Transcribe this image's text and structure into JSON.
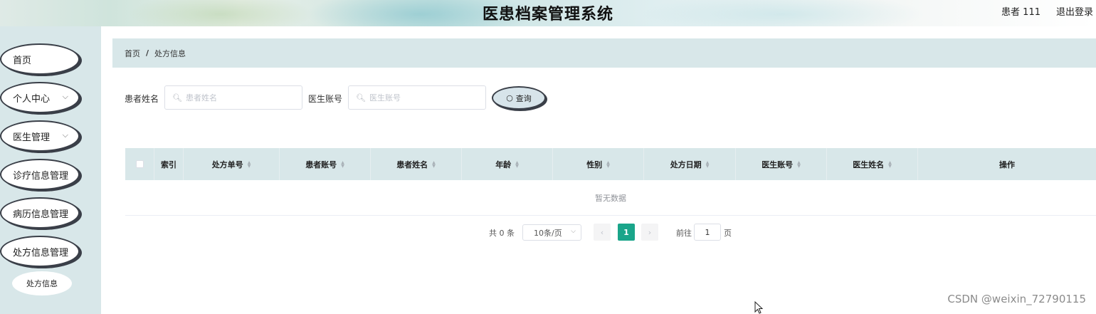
{
  "header": {
    "title": "医患档案管理系统",
    "user": "患者 111",
    "logout": "退出登录"
  },
  "sidebar": {
    "items": [
      {
        "label": "首页",
        "has_children": false
      },
      {
        "label": "个人中心",
        "has_children": true
      },
      {
        "label": "医生管理",
        "has_children": true
      },
      {
        "label": "诊疗信息管理",
        "has_children": false
      },
      {
        "label": "病历信息管理",
        "has_children": false
      },
      {
        "label": "处方信息管理",
        "has_children": false
      }
    ],
    "submenu": {
      "label": "处方信息"
    }
  },
  "breadcrumb": {
    "home": "首页",
    "separator": "/",
    "current": "处方信息"
  },
  "search": {
    "patient_name_label": "患者姓名",
    "patient_name_placeholder": "患者姓名",
    "doctor_account_label": "医生账号",
    "doctor_account_placeholder": "医生账号",
    "query_button": "查询"
  },
  "table": {
    "columns": [
      {
        "label": "索引",
        "sortable": false
      },
      {
        "label": "处方单号",
        "sortable": true
      },
      {
        "label": "患者账号",
        "sortable": true
      },
      {
        "label": "患者姓名",
        "sortable": true
      },
      {
        "label": "年龄",
        "sortable": true
      },
      {
        "label": "性别",
        "sortable": true
      },
      {
        "label": "处方日期",
        "sortable": true
      },
      {
        "label": "医生账号",
        "sortable": true
      },
      {
        "label": "医生姓名",
        "sortable": true
      },
      {
        "label": "操作",
        "sortable": false
      }
    ],
    "empty_text": "暂无数据"
  },
  "pagination": {
    "total": "共 0 条",
    "page_size": "10条/页",
    "prev": "‹",
    "next": "›",
    "current_page": "1",
    "goto_prefix": "前往",
    "goto_value": "1",
    "goto_suffix": "页"
  },
  "watermark": "CSDN @weixin_72790115",
  "colors": {
    "accent": "#1aa58a",
    "panel": "#d8e7e9"
  }
}
